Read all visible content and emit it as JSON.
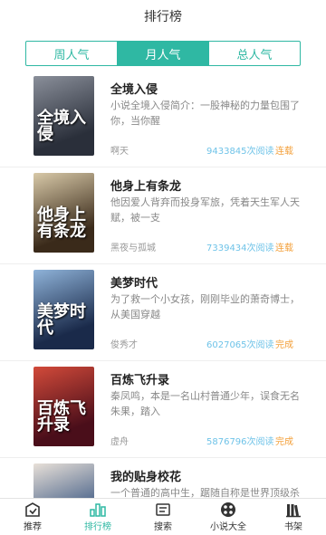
{
  "header": {
    "title": "排行榜"
  },
  "tabs": [
    {
      "label": "周人气",
      "active": false
    },
    {
      "label": "月人气",
      "active": true
    },
    {
      "label": "总人气",
      "active": false
    }
  ],
  "books": [
    {
      "title": "全境入侵",
      "desc": "小说全境入侵简介：一股神秘的力量包围了你，当你醒",
      "author": "啊天",
      "reads": "9433845次阅读",
      "status": "连载",
      "cover_text": "全境入侵",
      "cover_colors": [
        "#2a2f3a",
        "#8a8f9a"
      ]
    },
    {
      "title": "他身上有条龙",
      "desc": "他因爱人背弃而投身军旅，凭着天生军人天赋，被一支",
      "author": "黑夜与孤城",
      "reads": "7339434次阅读",
      "status": "连载",
      "cover_text": "他身上有条龙",
      "cover_colors": [
        "#3a2a1a",
        "#d8c9a8"
      ]
    },
    {
      "title": "美梦时代",
      "desc": "为了救一个小女孩，刚刚毕业的萧奇博士，从美国穿越",
      "author": "俊秀才",
      "reads": "6027065次阅读",
      "status": "完成",
      "cover_text": "美梦时代",
      "cover_colors": [
        "#1a2a4a",
        "#8fb3d9"
      ]
    },
    {
      "title": "百炼飞升录",
      "desc": "秦凤鸣，本是一名山村普通少年，误食无名朱果，踏入",
      "author": "虚舟",
      "reads": "5876796次阅读",
      "status": "完成",
      "cover_text": "百炼飞升录",
      "cover_colors": [
        "#4a0e1a",
        "#d24a3a"
      ]
    },
    {
      "title": "我的贴身校花",
      "desc": "一个普通的高中生，踞随自称是世界顶级杀手的鬼老头",
      "author": "",
      "reads": "",
      "status": "",
      "cover_text": "",
      "cover_colors": [
        "#2a4a7a",
        "#e8e0d8"
      ]
    }
  ],
  "nav": [
    {
      "label": "推荐",
      "icon": "recommend-icon",
      "active": false
    },
    {
      "label": "排行榜",
      "icon": "ranking-icon",
      "active": true
    },
    {
      "label": "搜索",
      "icon": "search-icon",
      "active": false
    },
    {
      "label": "小说大全",
      "icon": "catalog-icon",
      "active": false
    },
    {
      "label": "书架",
      "icon": "bookshelf-icon",
      "active": false
    }
  ],
  "colors": {
    "accent": "#2fb8a3",
    "reads": "#6fc3e8",
    "status": "#f3a03b"
  }
}
